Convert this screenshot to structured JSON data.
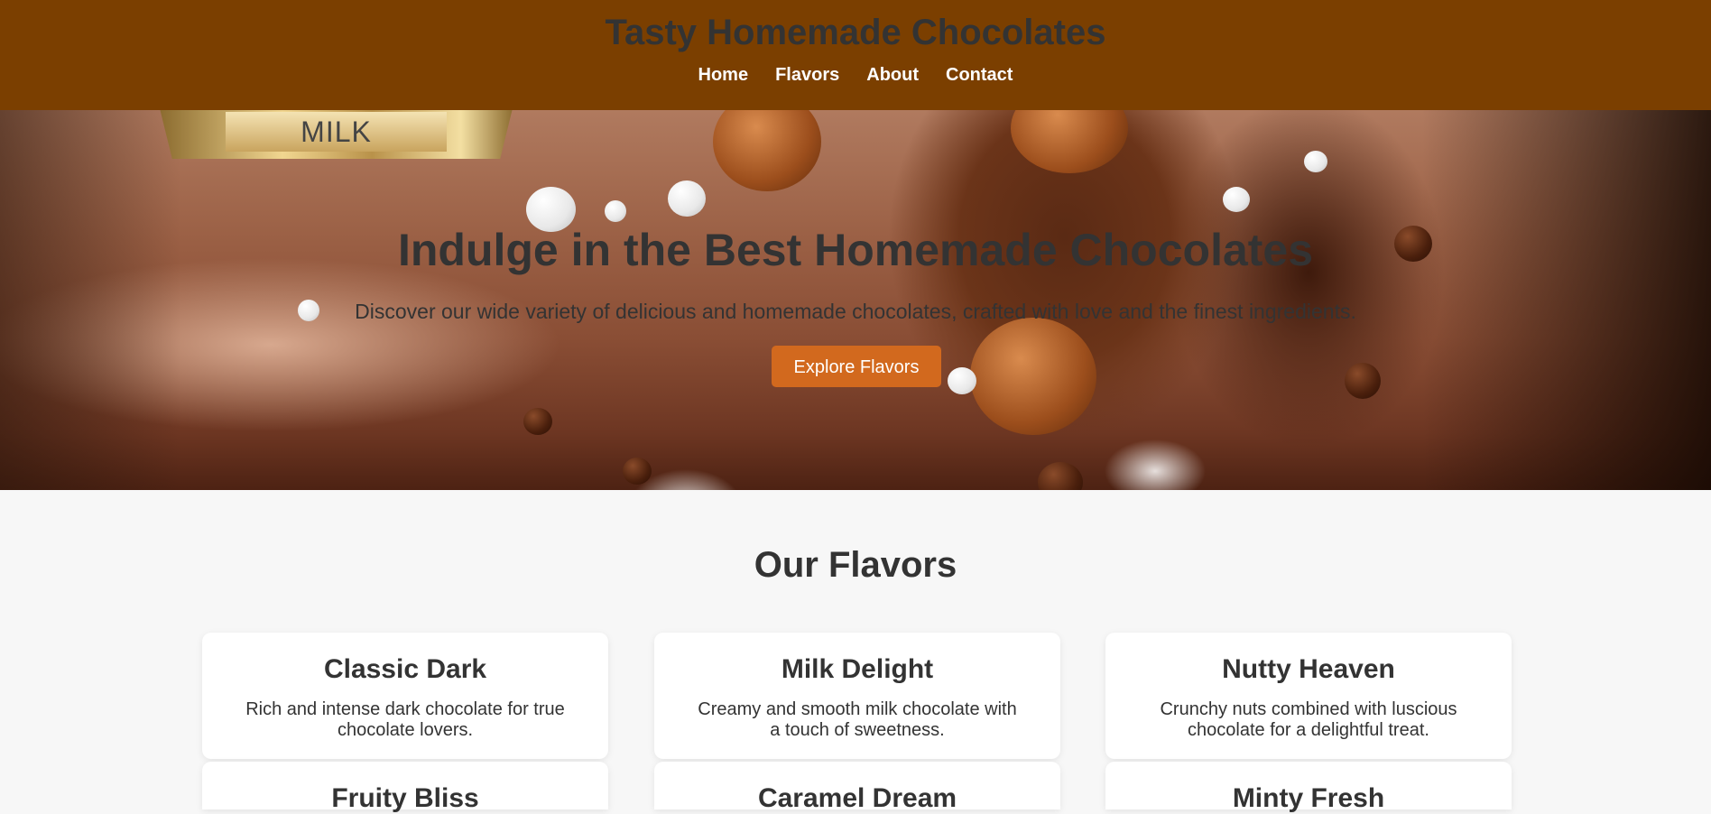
{
  "header": {
    "title": "Tasty Homemade Chocolates",
    "nav": [
      "Home",
      "Flavors",
      "About",
      "Contact"
    ]
  },
  "hero": {
    "badge_text": "MILK",
    "heading": "Indulge in the Best Homemade Chocolates",
    "subheading": "Discover our wide variety of delicious and homemade chocolates, crafted with love and the finest ingredients.",
    "cta_label": "Explore Flavors"
  },
  "flavors": {
    "title": "Our Flavors",
    "cards": [
      {
        "name": "Classic Dark",
        "desc": "Rich and intense dark chocolate for true chocolate lovers."
      },
      {
        "name": "Milk Delight",
        "desc": "Creamy and smooth milk chocolate with a touch of sweetness."
      },
      {
        "name": "Nutty Heaven",
        "desc": "Crunchy nuts combined with luscious chocolate for a delightful treat."
      },
      {
        "name": "Fruity Bliss",
        "desc": ""
      },
      {
        "name": "Caramel Dream",
        "desc": ""
      },
      {
        "name": "Minty Fresh",
        "desc": ""
      }
    ]
  },
  "colors": {
    "header_bg": "#7b3f00",
    "cta_bg": "#d2691e",
    "page_bg": "#f7f7f7",
    "text": "#333333"
  }
}
